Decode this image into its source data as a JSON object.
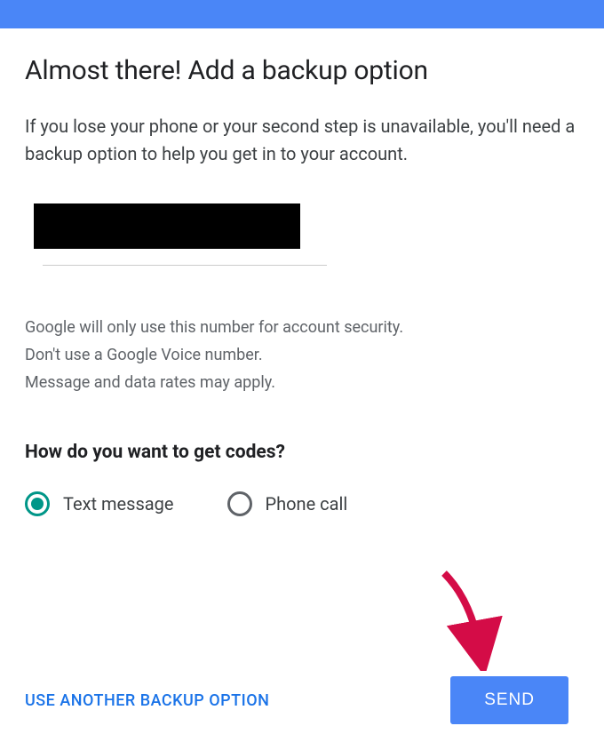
{
  "heading": "Almost there! Add a backup option",
  "description": "If you lose your phone or your second step is unavailable, you'll need a backup option to help you get in to your account.",
  "disclaimer": {
    "line1": "Google will only use this number for account security.",
    "line2": "Don't use a Google Voice number.",
    "line3": "Message and data rates may apply."
  },
  "section_title": "How do you want to get codes?",
  "radio": {
    "text_message": "Text message",
    "phone_call": "Phone call"
  },
  "footer": {
    "alt_option": "USE ANOTHER BACKUP OPTION",
    "send": "SEND"
  }
}
